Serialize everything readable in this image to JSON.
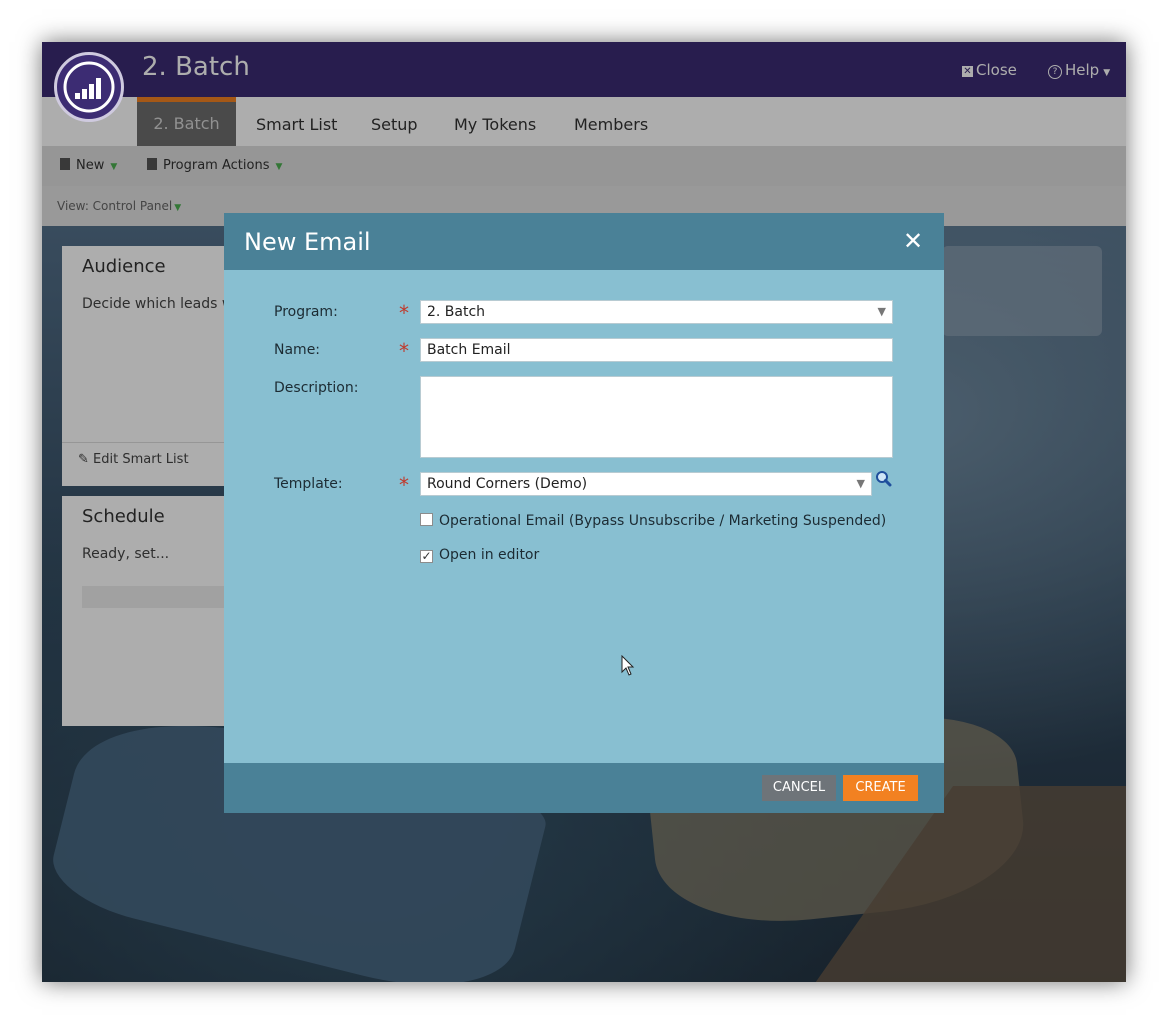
{
  "app": {
    "program_title": "2. Batch",
    "close_label": "Close",
    "help_label": "Help",
    "tabs": [
      {
        "label": "2. Batch",
        "active": true
      },
      {
        "label": "Smart List"
      },
      {
        "label": "Setup"
      },
      {
        "label": "My Tokens"
      },
      {
        "label": "Members"
      }
    ],
    "toolbar": {
      "new_label": "New",
      "program_actions_label": "Program Actions"
    },
    "view_label": "View: Control Panel",
    "audience_card": {
      "title": "Audience",
      "text": "Decide which leads wi",
      "link": "Edit Smart List"
    },
    "schedule_card": {
      "title": "Schedule",
      "text": "Ready, set..."
    }
  },
  "modal": {
    "title": "New Email",
    "program": {
      "label": "Program:",
      "value": "2. Batch"
    },
    "name": {
      "label": "Name:",
      "value": "Batch Email"
    },
    "description": {
      "label": "Description:",
      "value": ""
    },
    "template": {
      "label": "Template:",
      "value": "Round Corners (Demo)"
    },
    "operational_email": {
      "label": "Operational Email (Bypass Unsubscribe / Marketing Suspended)",
      "checked": false
    },
    "open_in_editor": {
      "label": "Open in editor",
      "checked": true
    },
    "required_marker": "*",
    "cancel_label": "CANCEL",
    "create_label": "CREATE"
  },
  "colors": {
    "topbar": "#3c2c73",
    "modal_header": "#4a8197",
    "modal_body": "#88bfd1",
    "create_button": "#f28121",
    "cancel_button": "#6e7479",
    "required": "#c0392b"
  }
}
